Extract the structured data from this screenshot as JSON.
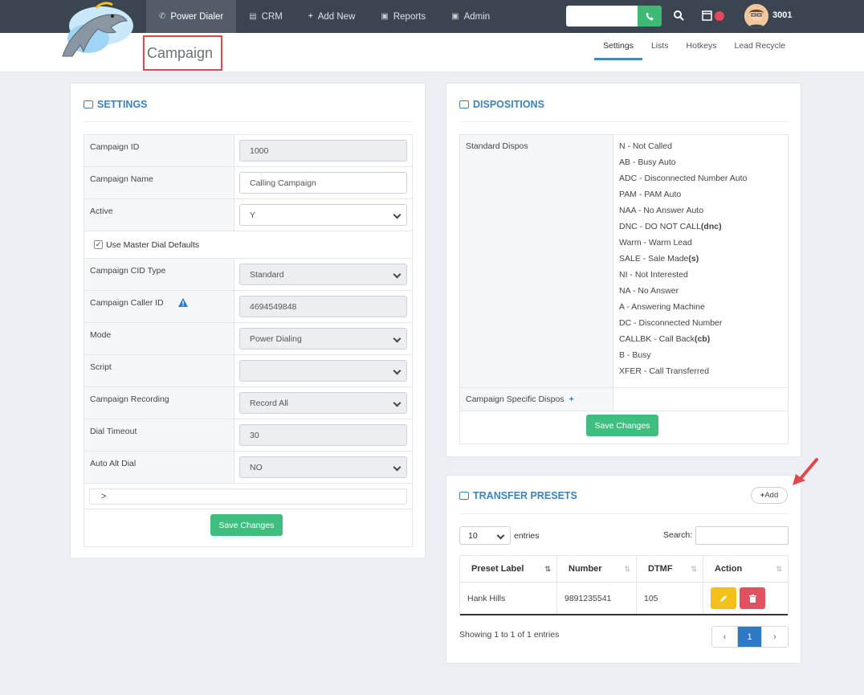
{
  "nav": {
    "items": [
      {
        "label": "Power Dialer",
        "icon": "phone-outline-icon",
        "active": true
      },
      {
        "label": "CRM",
        "icon": "book-icon",
        "active": false
      },
      {
        "label": "Add New",
        "icon": "plus-icon",
        "active": false
      },
      {
        "label": "Reports",
        "icon": "clipboard-icon",
        "active": false
      },
      {
        "label": "Admin",
        "icon": "lock-icon",
        "active": false
      }
    ],
    "user_ext": "3001"
  },
  "page": {
    "title": "Campaign",
    "subtabs": [
      {
        "label": "Settings",
        "active": true
      },
      {
        "label": "Lists",
        "active": false
      },
      {
        "label": "Hotkeys",
        "active": false
      },
      {
        "label": "Lead Recycle",
        "active": false
      }
    ]
  },
  "settings": {
    "title": "SETTINGS",
    "fields": {
      "campaign_id": {
        "label": "Campaign ID",
        "value": "1000"
      },
      "campaign_name": {
        "label": "Campaign Name",
        "value": "Calling Campaign"
      },
      "active": {
        "label": "Active",
        "value": "Y"
      },
      "master_defaults": {
        "label": "Use Master Dial Defaults",
        "checked": true
      },
      "cid_type": {
        "label": "Campaign CID Type",
        "value": "Standard"
      },
      "caller_id": {
        "label": "Campaign Caller ID",
        "value": "4694549848"
      },
      "mode": {
        "label": "Mode",
        "value": "Power Dialing"
      },
      "script": {
        "label": "Script",
        "value": ""
      },
      "recording": {
        "label": "Campaign Recording",
        "value": "Record All"
      },
      "dial_timeout": {
        "label": "Dial Timeout",
        "value": "30"
      },
      "auto_alt_dial": {
        "label": "Auto Alt Dial",
        "value": "NO"
      }
    },
    "expand_label": ">",
    "save_label": "Save Changes"
  },
  "dispositions": {
    "title": "DISPOSITIONS",
    "standard_label": "Standard Dispos",
    "items": [
      "N - Not Called",
      "AB - Busy Auto",
      "ADC - Disconnected Number Auto",
      "PAM - PAM Auto",
      "NAA - No Answer Auto",
      "DNC - DO NOT CALL",
      "Warm - Warm Lead",
      "SALE - Sale Made",
      "NI - Not Interested",
      "NA - No Answer",
      "A - Answering Machine",
      "DC - Disconnected Number",
      "CALLBK - Call Back",
      "B - Busy",
      "XFER - Call Transferred"
    ],
    "flags": {
      "dnc": "(dnc)",
      "sale": "(s)",
      "cb": "(cb)"
    },
    "specific_label": "Campaign Specific Dispos",
    "save_label": "Save Changes"
  },
  "transfer": {
    "title": "TRANSFER PRESETS",
    "add_label": "Add",
    "page_size": "10",
    "entries_label": "entries",
    "search_label": "Search:",
    "columns": [
      "Preset Label",
      "Number",
      "DTMF",
      "Action"
    ],
    "rows": [
      {
        "label": "Hank Hills",
        "number": "9891235541",
        "dtmf": "105"
      }
    ],
    "showing": "Showing 1 to 1 of 1 entries",
    "pager": {
      "prev": "‹",
      "current": "1",
      "next": "›"
    }
  },
  "colors": {
    "brand_blue": "#3d82b8",
    "success": "#3fbf7f",
    "warning": "#f2c21b",
    "danger": "#e05260",
    "highlight": "#e0474b"
  }
}
